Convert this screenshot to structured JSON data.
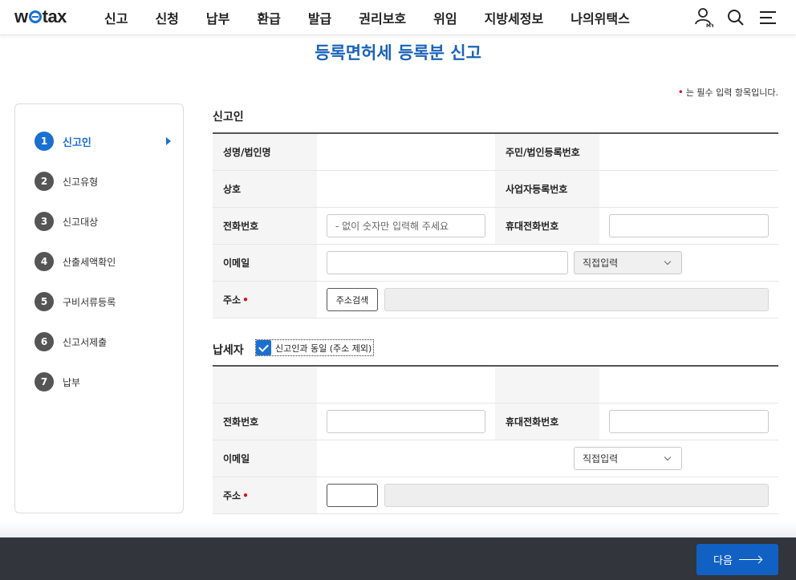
{
  "header": {
    "logo": "wetax",
    "menus": [
      "신고",
      "신청",
      "납부",
      "환급",
      "발급",
      "권리보호",
      "위임",
      "지방세정보",
      "나의위택스"
    ],
    "my_label": "MY"
  },
  "page_title": "등록면허세 등록분 신고",
  "required_note": "는 필수 입력 항목입니다.",
  "required_mark": "•",
  "steps": [
    {
      "num": "1",
      "label": "신고인"
    },
    {
      "num": "2",
      "label": "신고유형"
    },
    {
      "num": "3",
      "label": "신고대상"
    },
    {
      "num": "4",
      "label": "산출세액확인"
    },
    {
      "num": "5",
      "label": "구비서류등록"
    },
    {
      "num": "6",
      "label": "신고서제출"
    },
    {
      "num": "7",
      "label": "납부"
    }
  ],
  "reporter": {
    "title": "신고인",
    "name_label": "성명/법인명",
    "id_label": "주민/법인등록번호",
    "trade_label": "상호",
    "bizno_label": "사업자등록번호",
    "phone_label": "전화번호",
    "phone_placeholder": "- 없이 숫자만 입력해 주세요",
    "mobile_label": "휴대전화번호",
    "email_label": "이메일",
    "email_select": "직접입력",
    "addr_label": "주소",
    "addr_button": "주소검색"
  },
  "taxpayer": {
    "title": "납세자",
    "same_label": "신고인과 동일 (주소 제외)",
    "phone_label": "전화번호",
    "mobile_label": "휴대전화번호",
    "email_label": "이메일",
    "email_select": "직접입력",
    "addr_label": "주소"
  },
  "footer": {
    "next_label": "다음"
  }
}
